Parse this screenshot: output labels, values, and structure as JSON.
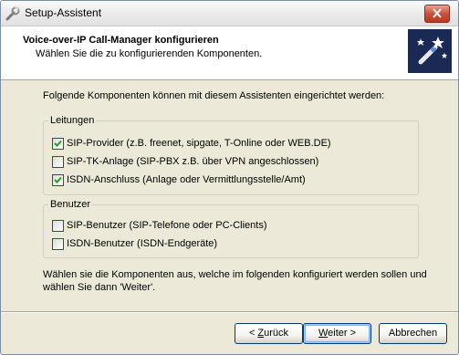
{
  "window": {
    "title": "Setup-Assistent"
  },
  "header": {
    "title": "Voice-over-IP Call-Manager konfigurieren",
    "subtitle": "Wählen Sie die zu konfigurierenden Komponenten."
  },
  "intro": "Folgende Komponenten können mit diesem Assistenten eingerichtet werden:",
  "groups": {
    "leitungen": {
      "label": "Leitungen",
      "items": [
        {
          "label": "SIP-Provider (z.B. freenet, sipgate, T-Online oder WEB.DE)",
          "checked": true
        },
        {
          "label": "SIP-TK-Anlage (SIP-PBX z.B. über VPN angeschlossen)",
          "checked": false
        },
        {
          "label": "ISDN-Anschluss (Anlage oder Vermittlungsstelle/Amt)",
          "checked": true
        }
      ]
    },
    "benutzer": {
      "label": "Benutzer",
      "items": [
        {
          "label": "SIP-Benutzer (SIP-Telefone oder PC-Clients)",
          "checked": false
        },
        {
          "label": "ISDN-Benutzer (ISDN-Endgeräte)",
          "checked": false
        }
      ]
    }
  },
  "outro": {
    "line1": "Wählen sie die Komponenten aus, welche im folgenden konfiguriert werden sollen und",
    "line2": "wählen Sie dann 'Weiter'."
  },
  "buttons": {
    "back_prefix": "< ",
    "back_mnemonic": "Z",
    "back_rest": "urück",
    "next_mnemonic": "W",
    "next_rest": "eiter >",
    "cancel": "Abbrechen"
  },
  "icons": {
    "app": "wrench-icon",
    "wizard": "magic-wand-icon",
    "close": "close-icon",
    "check": "checkmark-icon"
  },
  "colors": {
    "dialog_bg": "#ece9d8",
    "close_button": "#c8533c",
    "checkmark": "#21a121",
    "button_border": "#003c74"
  }
}
